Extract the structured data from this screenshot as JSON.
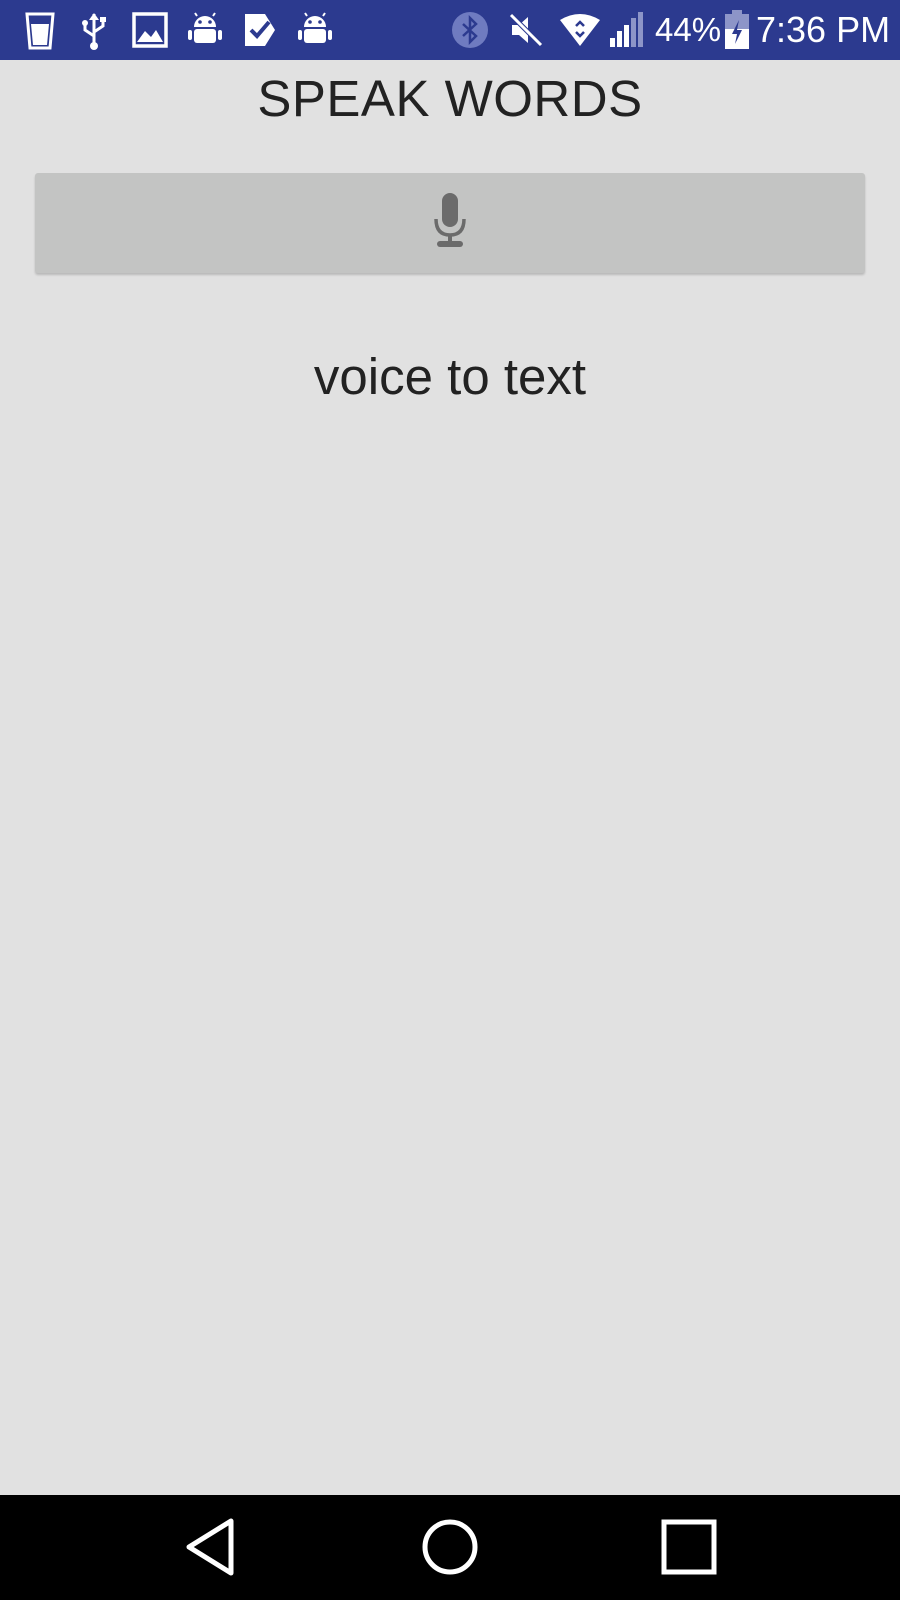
{
  "status_bar": {
    "background_color": "#2c3a8f",
    "left_icons": [
      "water-glass-icon",
      "usb-icon",
      "image-icon",
      "android-icon",
      "check-icon",
      "android-icon"
    ],
    "right_icons": [
      "bluetooth-icon",
      "mute-icon",
      "wifi-icon",
      "signal-icon",
      "battery-icon"
    ],
    "battery_percent": "44%",
    "time": "7:36 PM"
  },
  "app": {
    "title": "SPEAK WORDS",
    "mic_button_icon": "microphone-icon",
    "result_text": "voice to text",
    "background_color": "#e1e1e1",
    "button_color": "#c3c4c3"
  },
  "nav_bar": {
    "buttons": [
      "back",
      "home",
      "recents"
    ]
  }
}
